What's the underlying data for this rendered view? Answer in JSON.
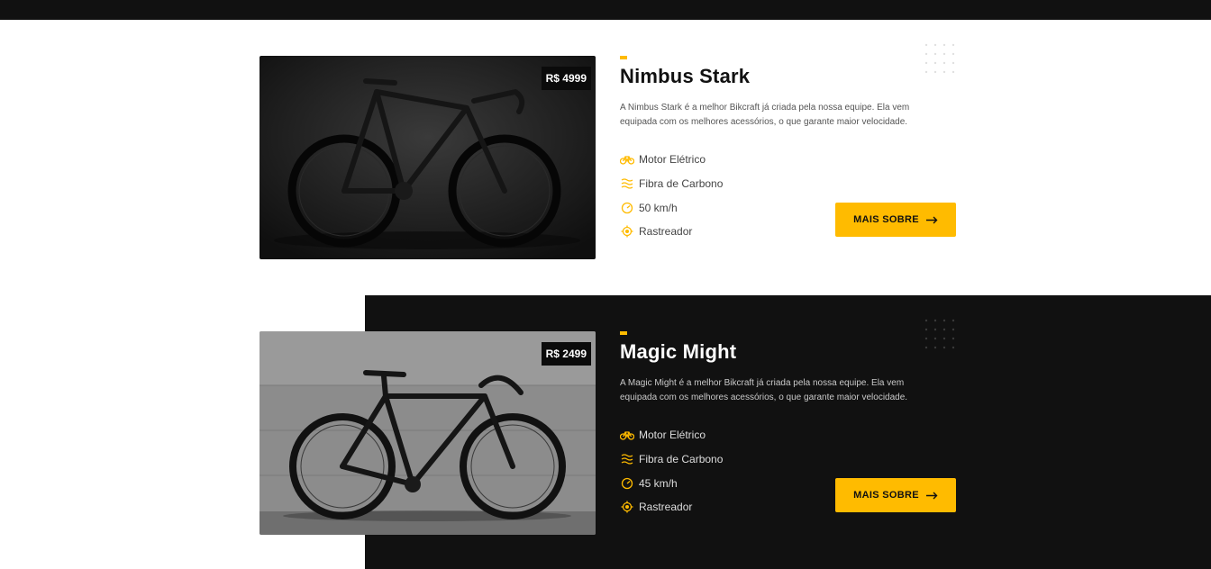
{
  "colors": {
    "accent": "#ffbb00",
    "dark": "#111111",
    "light": "#ffffff"
  },
  "products": [
    {
      "name": "Nimbus Stark",
      "price": "R$ 4999",
      "description": "A Nimbus Stark é a melhor Bikcraft já criada pela nossa equipe. Ela vem equipada com os melhores acessórios, o que garante maior velocidade.",
      "features": [
        {
          "icon": "electric-motor-icon",
          "label": "Motor Elétrico"
        },
        {
          "icon": "carbon-fiber-icon",
          "label": "Fibra de Carbono"
        },
        {
          "icon": "speedometer-icon",
          "label": "50 km/h"
        },
        {
          "icon": "tracker-icon",
          "label": "Rastreador"
        }
      ],
      "button_label": "MAIS SOBRE",
      "image": "black road bike on dark background"
    },
    {
      "name": "Magic Might",
      "price": "R$ 2499",
      "description": "A Magic Might é a melhor Bikcraft já criada pela nossa equipe. Ela vem equipada com os melhores acessórios, o que garante maior velocidade.",
      "features": [
        {
          "icon": "electric-motor-icon",
          "label": "Motor Elétrico"
        },
        {
          "icon": "carbon-fiber-icon",
          "label": "Fibra de Carbono"
        },
        {
          "icon": "speedometer-icon",
          "label": "45 km/h"
        },
        {
          "icon": "tracker-icon",
          "label": "Rastreador"
        }
      ],
      "button_label": "MAIS SOBRE",
      "image": "fixed gear bike leaning on concrete wall"
    }
  ]
}
